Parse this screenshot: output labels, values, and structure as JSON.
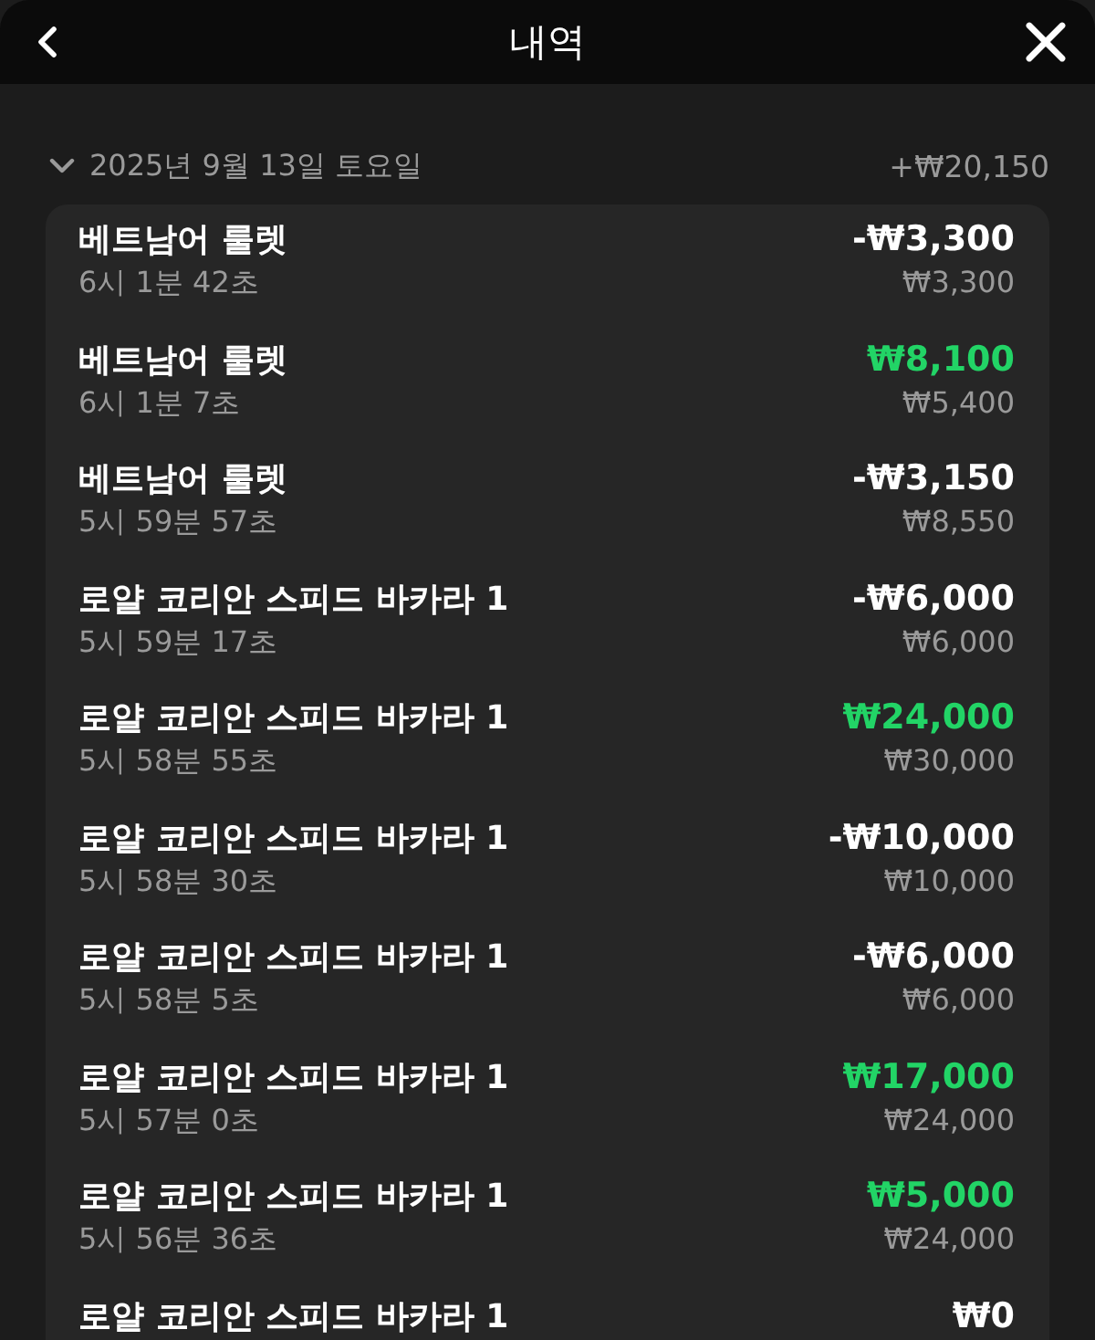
{
  "header": {
    "title": "내역"
  },
  "day_group": {
    "date": "2025년 9월 13일 토요일",
    "total": "+₩20,150",
    "expanded": true,
    "transactions": [
      {
        "game": "베트남어 룰렛",
        "time": "6시 1분 42초",
        "kind": "loss",
        "amount": "-₩3,300",
        "balance": "₩3,300"
      },
      {
        "game": "베트남어 룰렛",
        "time": "6시 1분 7초",
        "kind": "win",
        "amount": "₩8,100",
        "balance": "₩5,400"
      },
      {
        "game": "베트남어 룰렛",
        "time": "5시 59분 57초",
        "kind": "loss",
        "amount": "-₩3,150",
        "balance": "₩8,550"
      },
      {
        "game": "로얄 코리안 스피드 바카라 1",
        "time": "5시 59분 17초",
        "kind": "loss",
        "amount": "-₩6,000",
        "balance": "₩6,000"
      },
      {
        "game": "로얄 코리안 스피드 바카라 1",
        "time": "5시 58분 55초",
        "kind": "win",
        "amount": "₩24,000",
        "balance": "₩30,000"
      },
      {
        "game": "로얄 코리안 스피드 바카라 1",
        "time": "5시 58분 30초",
        "kind": "loss",
        "amount": "-₩10,000",
        "balance": "₩10,000"
      },
      {
        "game": "로얄 코리안 스피드 바카라 1",
        "time": "5시 58분 5초",
        "kind": "loss",
        "amount": "-₩6,000",
        "balance": "₩6,000"
      },
      {
        "game": "로얄 코리안 스피드 바카라 1",
        "time": "5시 57분 0초",
        "kind": "win",
        "amount": "₩17,000",
        "balance": "₩24,000"
      },
      {
        "game": "로얄 코리안 스피드 바카라 1",
        "time": "5시 56분 36초",
        "kind": "win",
        "amount": "₩5,000",
        "balance": "₩24,000"
      },
      {
        "game": "로얄 코리안 스피드 바카라 1",
        "kind": "zero",
        "amount": "₩0"
      }
    ]
  }
}
